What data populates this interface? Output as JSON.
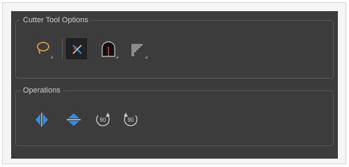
{
  "cutter_tool_options": {
    "title": "Cutter Tool Options",
    "tools": [
      {
        "icon": "lasso-icon",
        "selected": false
      },
      {
        "icon": "cutter-cross-icon",
        "selected": true
      },
      {
        "icon": "marquee-arch-icon",
        "selected": false
      },
      {
        "icon": "stair-shape-icon",
        "selected": false
      }
    ]
  },
  "operations": {
    "title": "Operations",
    "items": [
      {
        "icon": "flip-horizontal-icon"
      },
      {
        "icon": "flip-vertical-icon"
      },
      {
        "icon": "rotate-90-cw-icon",
        "label": "90"
      },
      {
        "icon": "rotate-90-ccw-icon",
        "label": "90"
      }
    ]
  },
  "colors": {
    "panel_bg": "#3c3c3c",
    "accent_blue": "#2f8fe8",
    "lasso_orange": "#e8a640",
    "cutter_red": "#e83838",
    "icon_gray": "#cfcfcf"
  }
}
